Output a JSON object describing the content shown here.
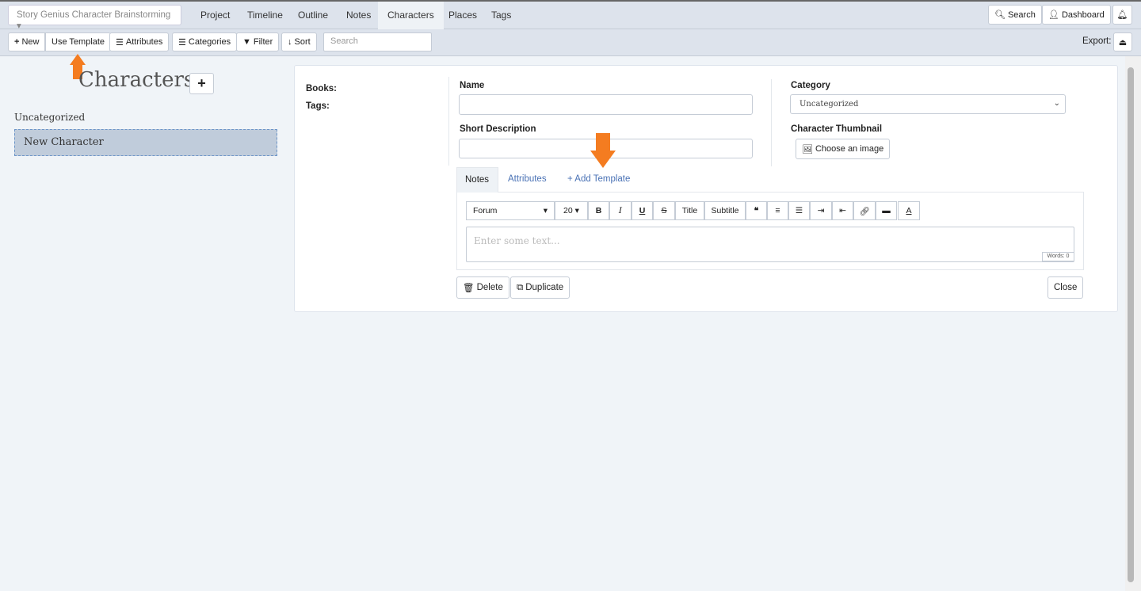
{
  "project": {
    "title": "Story Genius Character Brainstorming"
  },
  "nav": {
    "items": [
      "Project",
      "Timeline",
      "Outline",
      "Notes",
      "Characters",
      "Places",
      "Tags"
    ],
    "active": "Characters"
  },
  "header": {
    "search": "Search",
    "dashboard": "Dashboard"
  },
  "toolbar": {
    "new": "New",
    "use_template": "Use Template",
    "attributes": "Attributes",
    "categories": "Categories",
    "filter": "Filter",
    "sort": "Sort",
    "search_placeholder": "Search",
    "export": "Export:"
  },
  "sidebar": {
    "title": "Characters",
    "group": "Uncategorized",
    "items": [
      "New Character"
    ]
  },
  "detail": {
    "books_label": "Books:",
    "tags_label": "Tags:",
    "name_label": "Name",
    "name_value": "",
    "short_desc_label": "Short Description",
    "category_label": "Category",
    "category_value": "Uncategorized",
    "thumbnail_label": "Character Thumbnail",
    "choose_image": "Choose an image",
    "tabs": [
      "Notes",
      "Attributes",
      "+ Add Template"
    ],
    "active_tab": "Notes",
    "editor": {
      "font": "Forum",
      "size": "20",
      "title": "Title",
      "subtitle": "Subtitle",
      "placeholder": "Enter some text...",
      "words": "Words: 0"
    },
    "delete": "Delete",
    "duplicate": "Duplicate",
    "close": "Close"
  },
  "colors": {
    "accent_arrow": "#f47c20",
    "selected_item": "#c0ccdb"
  }
}
